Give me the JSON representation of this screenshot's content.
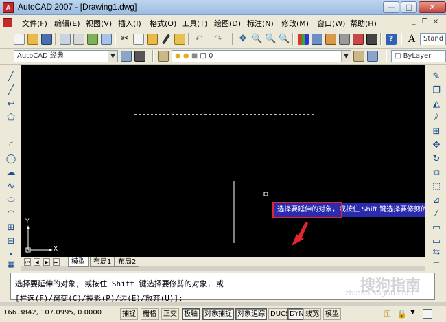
{
  "window": {
    "title": "AutoCAD 2007 - [Drawing1.dwg]",
    "app_icon": "A"
  },
  "window_controls": {
    "minimize": "—",
    "maximize": "□",
    "close": "✕"
  },
  "menu": {
    "items": [
      "文件(F)",
      "编辑(E)",
      "视图(V)",
      "插入(I)",
      "格式(O)",
      "工具(T)",
      "绘图(D)",
      "标注(N)",
      "修改(M)",
      "窗口(W)",
      "帮助(H)"
    ],
    "mdi_controls": {
      "minimize": "_",
      "restore": "❐",
      "close": "×"
    }
  },
  "toolbar": {
    "text_style_combo": "Stand",
    "workspace_combo": "AutoCAD 经典",
    "layer_combo": "0",
    "linetype_combo": "ByLayer"
  },
  "canvas": {
    "ucs_y": "Y",
    "ucs_x": "X",
    "tooltip_prompt": "选择要延伸的对象",
    "tooltip_rest": "，或按住 Shift 键选择要修剪的对象"
  },
  "layout_tabs": [
    "模型",
    "布局1",
    "布局2"
  ],
  "command": {
    "line1": "选择要延伸的对象, 或按住 Shift 键选择要修剪的对象, 或",
    "line2": "[栏选(F)/窗交(C)/投影(P)/边(E)/放弃(U)]:"
  },
  "watermark": {
    "main": "搜狗指南",
    "sub": "zhinan.sogou.com"
  },
  "status": {
    "coords": "166.3842,  107.0995, 0.0000",
    "buttons": [
      "捕捉",
      "栅格",
      "正交",
      "极轴",
      "对象捕捉",
      "对象追踪",
      "DUCS",
      "DYN",
      "线宽",
      "模型"
    ]
  },
  "colors": {
    "canvas": "#000000",
    "tooltip": "#2b2bb0",
    "highlight": "#e0262e",
    "arrow": "#e0262e"
  }
}
